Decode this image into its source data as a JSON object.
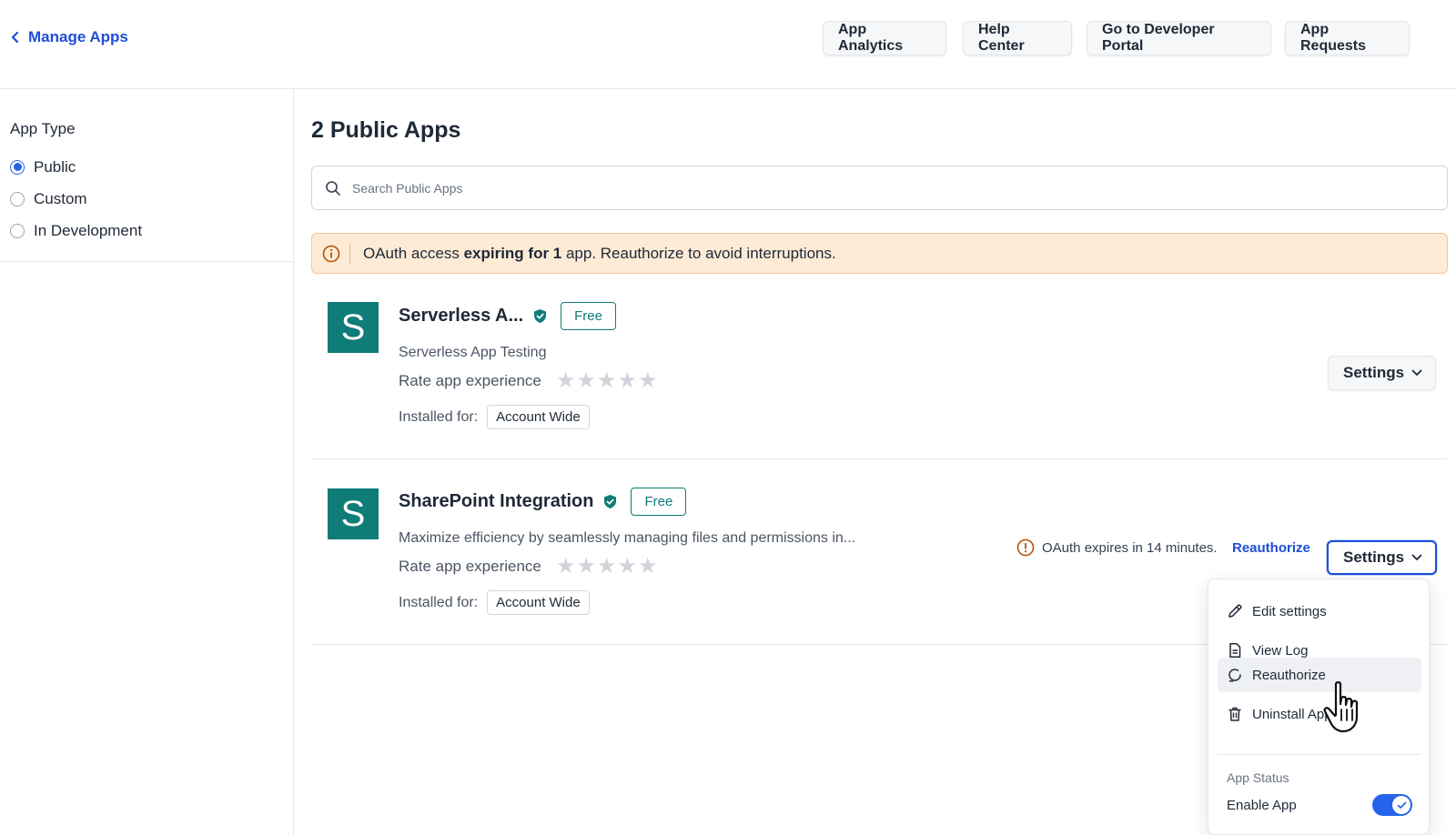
{
  "header": {
    "back_label": "Manage Apps",
    "buttons": [
      "App Analytics",
      "Help Center",
      "Go to Developer Portal",
      "App Requests"
    ]
  },
  "sidebar": {
    "title": "App Type",
    "options": [
      {
        "label": "Public",
        "checked": true
      },
      {
        "label": "Custom",
        "checked": false
      },
      {
        "label": "In Development",
        "checked": false
      }
    ]
  },
  "main": {
    "title": "2 Public Apps",
    "search_placeholder": "Search Public Apps",
    "banner": {
      "prefix": "OAuth access ",
      "bold": "expiring for 1",
      "suffix": " app. Reauthorize to avoid interruptions."
    },
    "apps": [
      {
        "logo_letter": "S",
        "name": "Serverless A...",
        "badge": "Free",
        "description": "Serverless App Testing",
        "rate_label": "Rate app experience",
        "installed_label": "Installed for:",
        "installed_value": "Account Wide",
        "settings_label": "Settings"
      },
      {
        "logo_letter": "S",
        "name": "SharePoint Integration",
        "badge": "Free",
        "description": "Maximize efficiency by seamlessly managing files and permissions in...",
        "rate_label": "Rate app experience",
        "installed_label": "Installed for:",
        "installed_value": "Account Wide",
        "settings_label": "Settings",
        "oauth_warning": "OAuth expires in 14 minutes.",
        "reauthorize_label": "Reauthorize"
      }
    ]
  },
  "dropdown": {
    "items": [
      "Edit settings",
      "View Log",
      "Reauthorize",
      "Uninstall App"
    ],
    "section_label": "App Status",
    "toggle_label": "Enable App",
    "toggle_on": true
  },
  "colors": {
    "accent": "#1d4ed8",
    "brand_teal": "#0f7c78",
    "banner_bg": "#fdebd6",
    "warning_icon": "#b45309"
  },
  "icons": [
    "chevron-left-icon",
    "search-icon",
    "info-icon",
    "verified-shield-icon",
    "star-icon",
    "chevron-down-icon",
    "warning-icon",
    "pencil-icon",
    "document-icon",
    "refresh-icon",
    "trash-icon",
    "check-icon",
    "hand-pointer-cursor-icon"
  ]
}
